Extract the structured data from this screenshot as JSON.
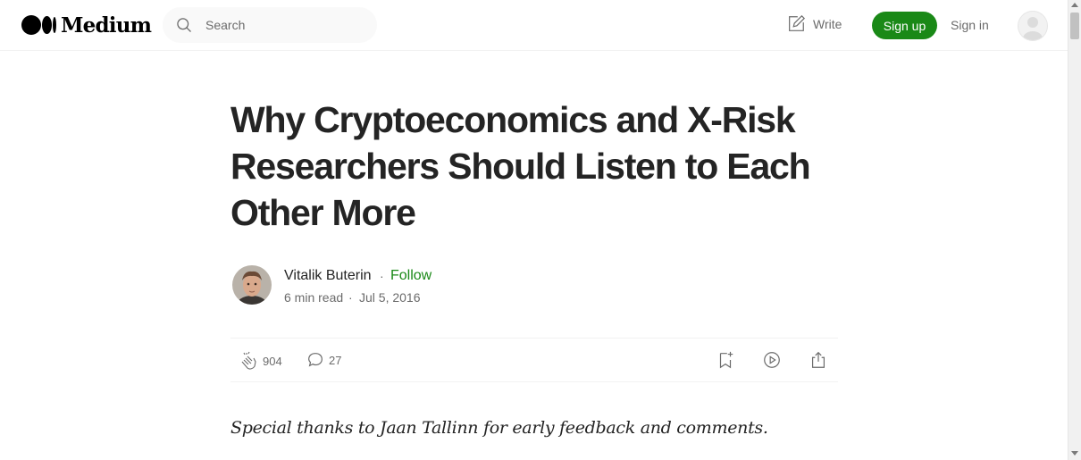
{
  "nav": {
    "logo_text": "Medium",
    "search_placeholder": "Search",
    "write_label": "Write",
    "signup_label": "Sign up",
    "signin_label": "Sign in"
  },
  "article": {
    "title": "Why Cryptoeconomics and X-Risk Researchers Should Listen to Each Other More",
    "author": "Vitalik Buterin",
    "follow_label": "Follow",
    "separator": "·",
    "read_time": "6 min read",
    "date": "Jul 5, 2016",
    "claps": "904",
    "responses": "27",
    "intro": "Special thanks to Jaan Tallinn for early feedback and comments."
  },
  "colors": {
    "accent": "#1a8917",
    "text": "#242424",
    "muted": "#6b6b6b"
  },
  "icons": [
    "search-icon",
    "write-icon",
    "clap-icon",
    "comment-icon",
    "bookmark-icon",
    "play-icon",
    "share-icon"
  ]
}
